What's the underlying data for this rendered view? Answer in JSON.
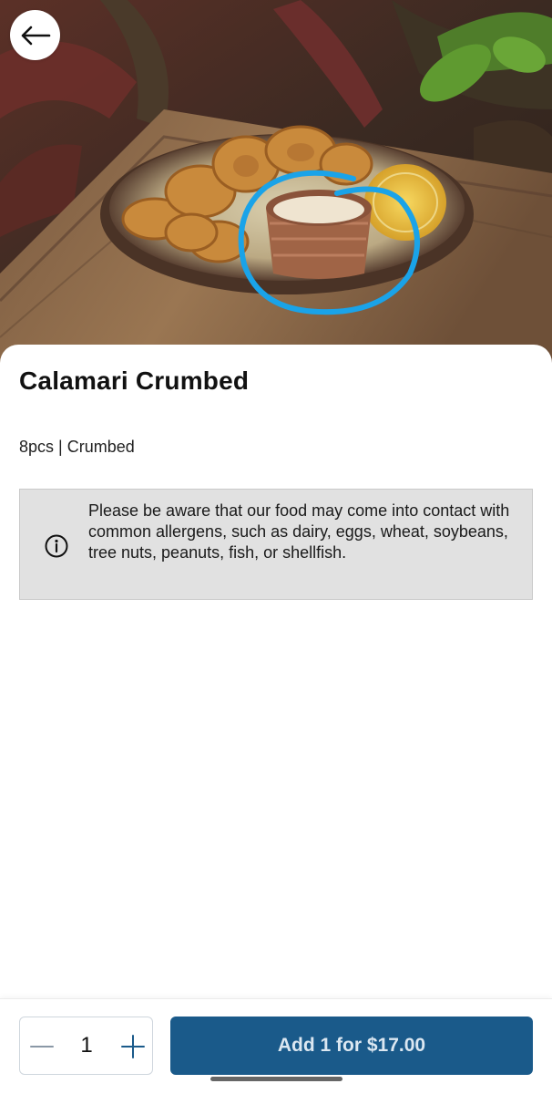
{
  "product": {
    "name": "Calamari Crumbed",
    "details": "8pcs | Crumbed"
  },
  "allergen_notice": {
    "text": "Please be aware that our food may come into contact with common allergens, such as dairy, eggs, wheat, soybeans, tree nuts, peanuts, fish, or shellfish.",
    "icon": "info-circle-icon"
  },
  "navigation": {
    "back_icon": "arrow-left-icon"
  },
  "order": {
    "quantity": "1",
    "add_button_label": "Add 1 for $17.00"
  },
  "colors": {
    "primary_button": "#1a5a8a",
    "annotation_circle": "#1aa3e8",
    "notice_background": "#e1e1e1"
  }
}
